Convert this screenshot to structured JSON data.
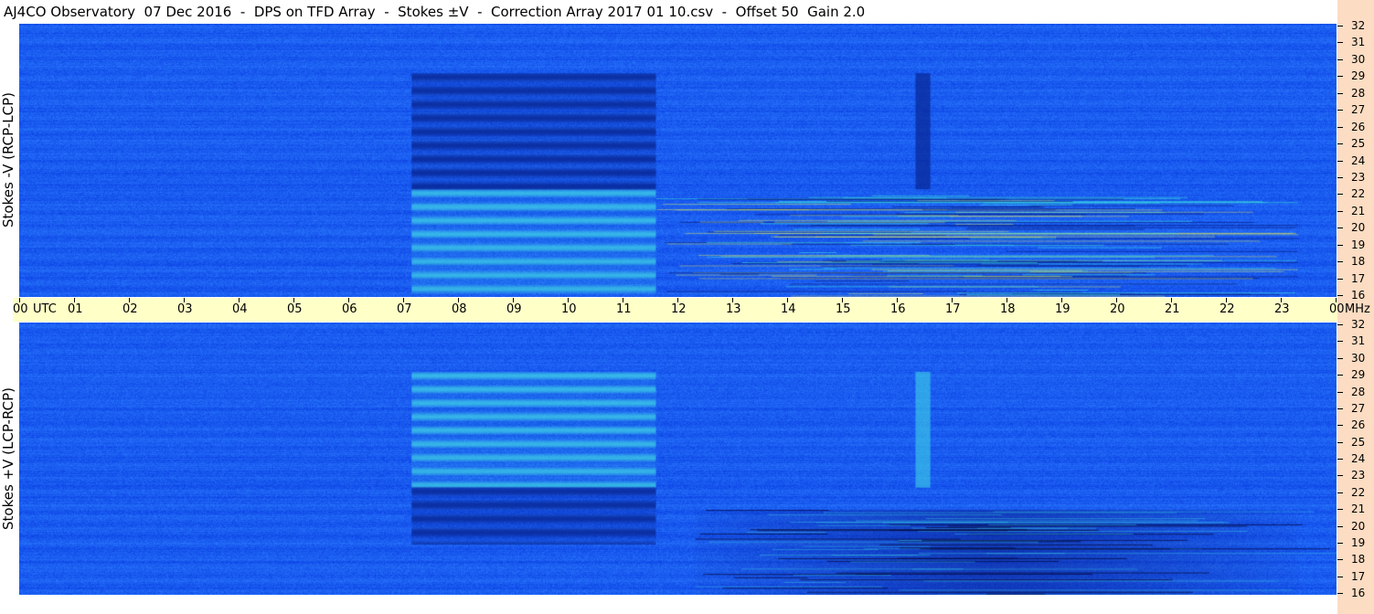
{
  "title": "AJ4CO Observatory  07 Dec 2016  -  DPS on TFD Array  -  Stokes ±V  -  Correction Array 2017 01 10.csv  -  Offset 50  Gain 2.0",
  "colors": {
    "background_base": "#1a5cf0",
    "dark_band": "#0a2a9a",
    "bright_band": "#3fd3e6",
    "x_axis_band": "#ffffc8",
    "y_axis_strip": "#fcdcc2"
  },
  "chart_data": [
    {
      "type": "heatmap",
      "panel": "top",
      "ylabel": "Stokes -V (RCP-LCP)",
      "y_unit": "MHz",
      "ylim": [
        16,
        32
      ],
      "y_ticks": [
        "32",
        "31",
        "30",
        "29",
        "28",
        "27",
        "26",
        "25",
        "24",
        "23",
        "22",
        "21",
        "20",
        "19",
        "18",
        "17",
        "16"
      ],
      "xlim": [
        0,
        24
      ],
      "features": [
        {
          "kind": "dark_banded_block",
          "x_start": 7.15,
          "x_end": 11.6,
          "y_start": 22.3,
          "y_end": 29.1
        },
        {
          "kind": "bright_banded_block",
          "x_start": 7.15,
          "x_end": 11.6,
          "y_start": 16.2,
          "y_end": 22.3
        },
        {
          "kind": "dark_vertical_strip",
          "x_start": 16.33,
          "x_end": 16.6,
          "y_start": 22.3,
          "y_end": 29.1
        },
        {
          "kind": "interference_region",
          "x_start": 11.6,
          "x_end": 23.3,
          "y_start": 16.0,
          "y_end": 22.0
        }
      ]
    },
    {
      "type": "heatmap",
      "panel": "bottom",
      "ylabel": "Stokes +V (LCP-RCP)",
      "y_unit": "MHz",
      "ylim": [
        16,
        32
      ],
      "y_ticks": [
        "32",
        "31",
        "30",
        "29",
        "28",
        "27",
        "26",
        "25",
        "24",
        "23",
        "22",
        "21",
        "20",
        "19",
        "18",
        "17",
        "16"
      ],
      "xlim": [
        0,
        24
      ],
      "features": [
        {
          "kind": "bright_banded_block",
          "x_start": 7.15,
          "x_end": 11.6,
          "y_start": 22.3,
          "y_end": 29.1
        },
        {
          "kind": "dark_banded_block",
          "x_start": 7.15,
          "x_end": 11.6,
          "y_start": 19.0,
          "y_end": 22.3
        },
        {
          "kind": "bright_vertical_strip",
          "x_start": 16.33,
          "x_end": 16.6,
          "y_start": 22.3,
          "y_end": 29.1
        },
        {
          "kind": "dark_region",
          "x_start": 12.3,
          "x_end": 23.3,
          "y_start": 16.0,
          "y_end": 21.0
        }
      ]
    }
  ],
  "x_axis": {
    "ticks": [
      "00",
      "01",
      "02",
      "03",
      "04",
      "05",
      "06",
      "07",
      "08",
      "09",
      "10",
      "11",
      "12",
      "13",
      "14",
      "15",
      "16",
      "17",
      "18",
      "19",
      "20",
      "21",
      "22",
      "23",
      "00"
    ],
    "first_unit": "UTC",
    "last_unit": "MHz"
  }
}
